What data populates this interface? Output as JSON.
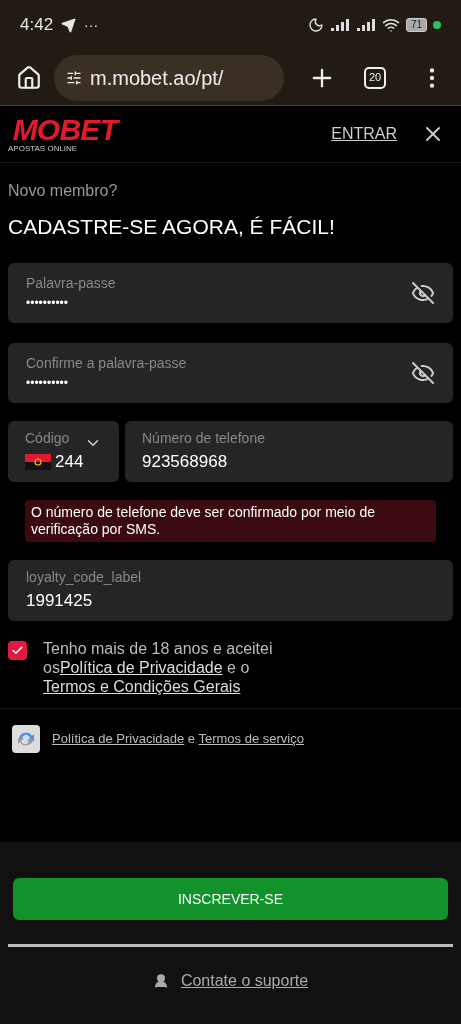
{
  "status_bar": {
    "time": "4:42",
    "more": "···",
    "battery": "71"
  },
  "browser": {
    "url": "m.mobet.ao/pt/",
    "tab_count": "20"
  },
  "header": {
    "logo": "MOBET",
    "logo_tagline": "APOSTAS ONLINE",
    "login": "ENTRAR"
  },
  "intro": {
    "subtitle": "Novo membro?",
    "title": "CADASTRE-SE AGORA, É FÁCIL!"
  },
  "password_fields": [
    {
      "label": "Palavra-passe",
      "value": "••••••••••"
    },
    {
      "label": "Confirme a palavra-passe",
      "value": "••••••••••"
    }
  ],
  "phone": {
    "code_label": "Código",
    "code": "244",
    "number_label": "Número de telefone",
    "number": "923568968"
  },
  "error": "O número de telefone deve ser confirmado por meio de verificação por SMS.",
  "loyalty": {
    "label": "loyalty_code_label",
    "value": "1991425"
  },
  "terms": {
    "checked": true,
    "parts": [
      {
        "kind": "text",
        "text": "Tenho mais de 18 anos e aceitei os"
      },
      {
        "kind": "link",
        "text": "Política de Privacidade"
      },
      {
        "kind": "text",
        "text": " e o  "
      },
      {
        "kind": "link",
        "text": "Termos e Condições Gerais"
      }
    ]
  },
  "recaptcha": {
    "parts": [
      {
        "kind": "link",
        "text": "Política de Privacidade"
      },
      {
        "kind": "text",
        "text": " e "
      },
      {
        "kind": "link",
        "text": "Termos de serviço"
      }
    ]
  },
  "submit": "INSCREVER-SE",
  "support": "Contate o suporte"
}
